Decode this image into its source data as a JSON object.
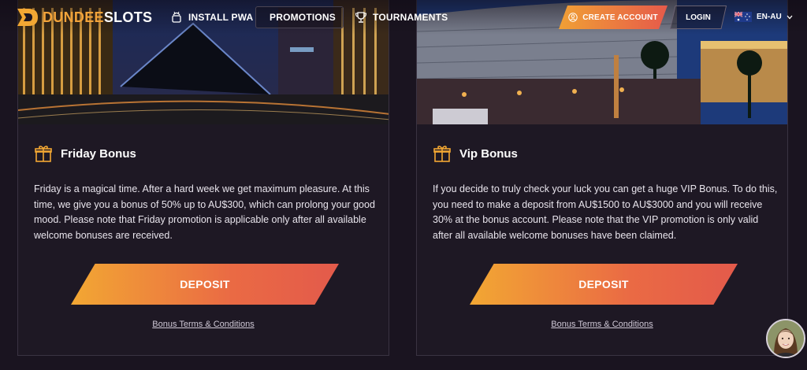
{
  "header": {
    "logo_primary": "DUNDEE",
    "logo_secondary": "SLOTS",
    "nav": [
      {
        "label": "INSTALL PWA",
        "icon": "android-icon"
      },
      {
        "label": "PROMOTIONS",
        "icon": "promotions-icon",
        "active": true
      },
      {
        "label": "TOURNAMENTS",
        "icon": "trophy-icon"
      }
    ],
    "create_account_label": "CREATE ACCOUNT",
    "login_label": "LOGIN",
    "language": "EN-AU"
  },
  "cards": [
    {
      "title": "Friday Bonus",
      "text": "Friday is a magical time. After a hard week we get maximum pleasure. At this time, we give you a bonus of 50% up to AU$300, which can prolong your good mood. Please note that Friday promotion is applicable only after all available welcome bonuses are received.",
      "button": "DEPOSIT",
      "terms": "Bonus Terms & Conditions"
    },
    {
      "title": "Vip Bonus",
      "text": "If you decide to truly check your luck you can get a huge VIP Bonus. To do this, you need to make a deposit from AU$1500 to AU$3000 and you will receive 30% at the bonus account. Please note that the VIP promotion is only valid after all available welcome bonuses have been claimed.",
      "button": "DEPOSIT",
      "terms": "Bonus Terms & Conditions"
    }
  ],
  "colors": {
    "accent_orange": "#f2a733",
    "accent_red": "#e35a4b",
    "background": "#1a1420",
    "card": "#1e1824"
  }
}
